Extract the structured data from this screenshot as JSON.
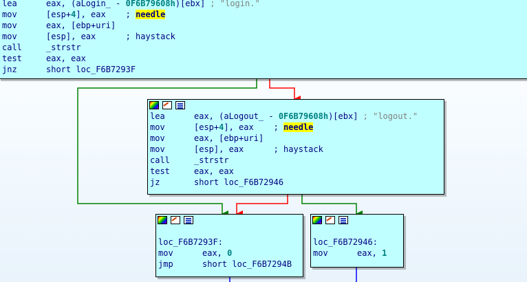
{
  "nodes": [
    {
      "id": "block-top",
      "lines": [
        {
          "m": "lea",
          "op": [
            "eax, (aLogin_ - ",
            {
              "t": "num",
              "v": "0F6B79608h"
            },
            ")[ebx]"
          ],
          "cmt": " ; \"login.\""
        },
        {
          "m": "mov",
          "op": [
            "[esp+",
            {
              "t": "num",
              "v": "4"
            },
            "], eax    ; "
          ],
          "hl": "needle"
        },
        {
          "m": "mov",
          "op": [
            "eax, [ebp+",
            {
              "t": "loc",
              "v": "uri"
            },
            "]"
          ]
        },
        {
          "m": "mov",
          "op": [
            "[esp], eax      ; haystack"
          ]
        },
        {
          "m": "call",
          "op": [
            "_strstr"
          ]
        },
        {
          "m": "test",
          "op": [
            "eax, eax"
          ]
        },
        {
          "m": "jnz",
          "op": [
            "short loc_F6B7293F"
          ]
        }
      ]
    },
    {
      "id": "block-logout",
      "lines": [
        {
          "m": "lea",
          "op": [
            "eax, (aLogout_ - ",
            {
              "t": "num",
              "v": "0F6B79608h"
            },
            ")[ebx]"
          ],
          "cmt": " ; \"logout.\""
        },
        {
          "m": "mov",
          "op": [
            "[esp+",
            {
              "t": "num",
              "v": "4"
            },
            "], eax    ; "
          ],
          "hl": "needle"
        },
        {
          "m": "mov",
          "op": [
            "eax, [ebp+",
            {
              "t": "loc",
              "v": "uri"
            },
            "]"
          ]
        },
        {
          "m": "mov",
          "op": [
            "[esp], eax      ; haystack"
          ]
        },
        {
          "m": "call",
          "op": [
            "_strstr"
          ]
        },
        {
          "m": "test",
          "op": [
            "eax, eax"
          ]
        },
        {
          "m": "jz",
          "op": [
            "short loc_F6B72946"
          ]
        }
      ]
    },
    {
      "id": "block-left",
      "lines": [
        {
          "m": "",
          "op": []
        },
        {
          "label": "loc_F6B7293F:"
        },
        {
          "m": "mov",
          "op": [
            "eax, ",
            {
              "t": "num",
              "v": "0"
            }
          ]
        },
        {
          "m": "jmp",
          "op": [
            "short loc_F6B7294B"
          ]
        }
      ]
    },
    {
      "id": "block-right",
      "lines": [
        {
          "m": "",
          "op": []
        },
        {
          "label": "loc_F6B72946:"
        },
        {
          "m": "mov",
          "op": [
            "eax, ",
            {
              "t": "num",
              "v": "1"
            }
          ]
        }
      ]
    }
  ],
  "colors": {
    "node_bg": "#c0ffff",
    "edge_true": "#008000",
    "edge_false": "#ff0000",
    "edge_uncond": "#0000ff",
    "highlight": "#ffff00"
  }
}
